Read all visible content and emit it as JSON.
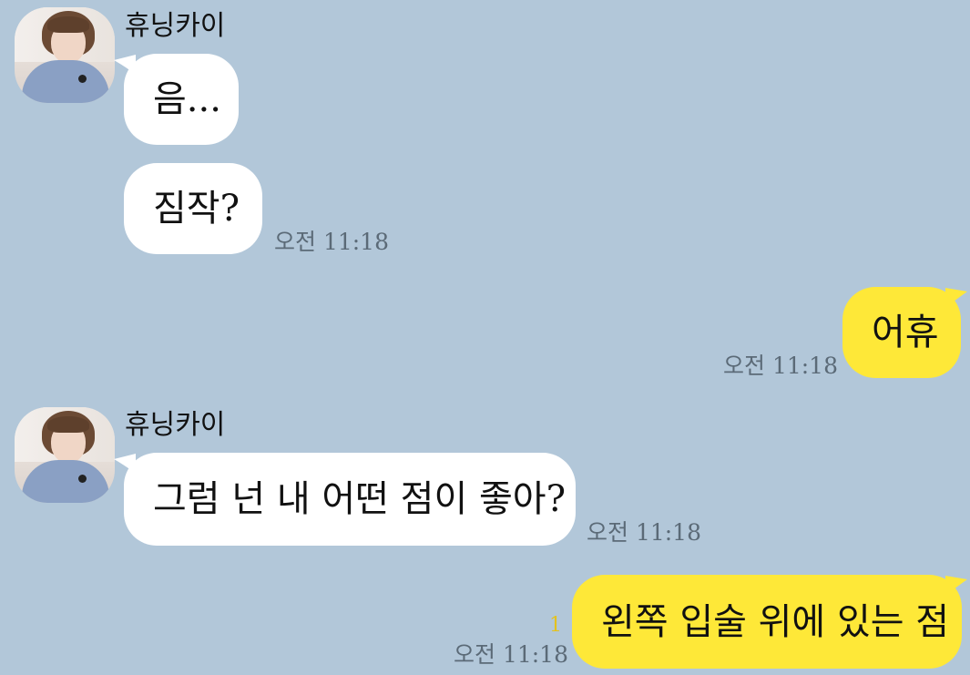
{
  "sender_name": "휴닝카이",
  "messages": [
    {
      "side": "left",
      "text": "음..."
    },
    {
      "side": "left",
      "text": "짐작?",
      "time": "오전 11:18"
    },
    {
      "side": "right",
      "text": "어휴",
      "time": "오전 11:18"
    },
    {
      "side": "left",
      "text": "그럼 넌 내 어떤 점이 좋아?",
      "time": "오전 11:18"
    },
    {
      "side": "right",
      "text": "왼쪽 입술 위에 있는 점",
      "time": "오전 11:18",
      "unread": "1"
    }
  ],
  "colors": {
    "background": "#b2c7d9",
    "my_bubble": "#fee838",
    "their_bubble": "#ffffff",
    "unread_count": "#e4c21e"
  }
}
